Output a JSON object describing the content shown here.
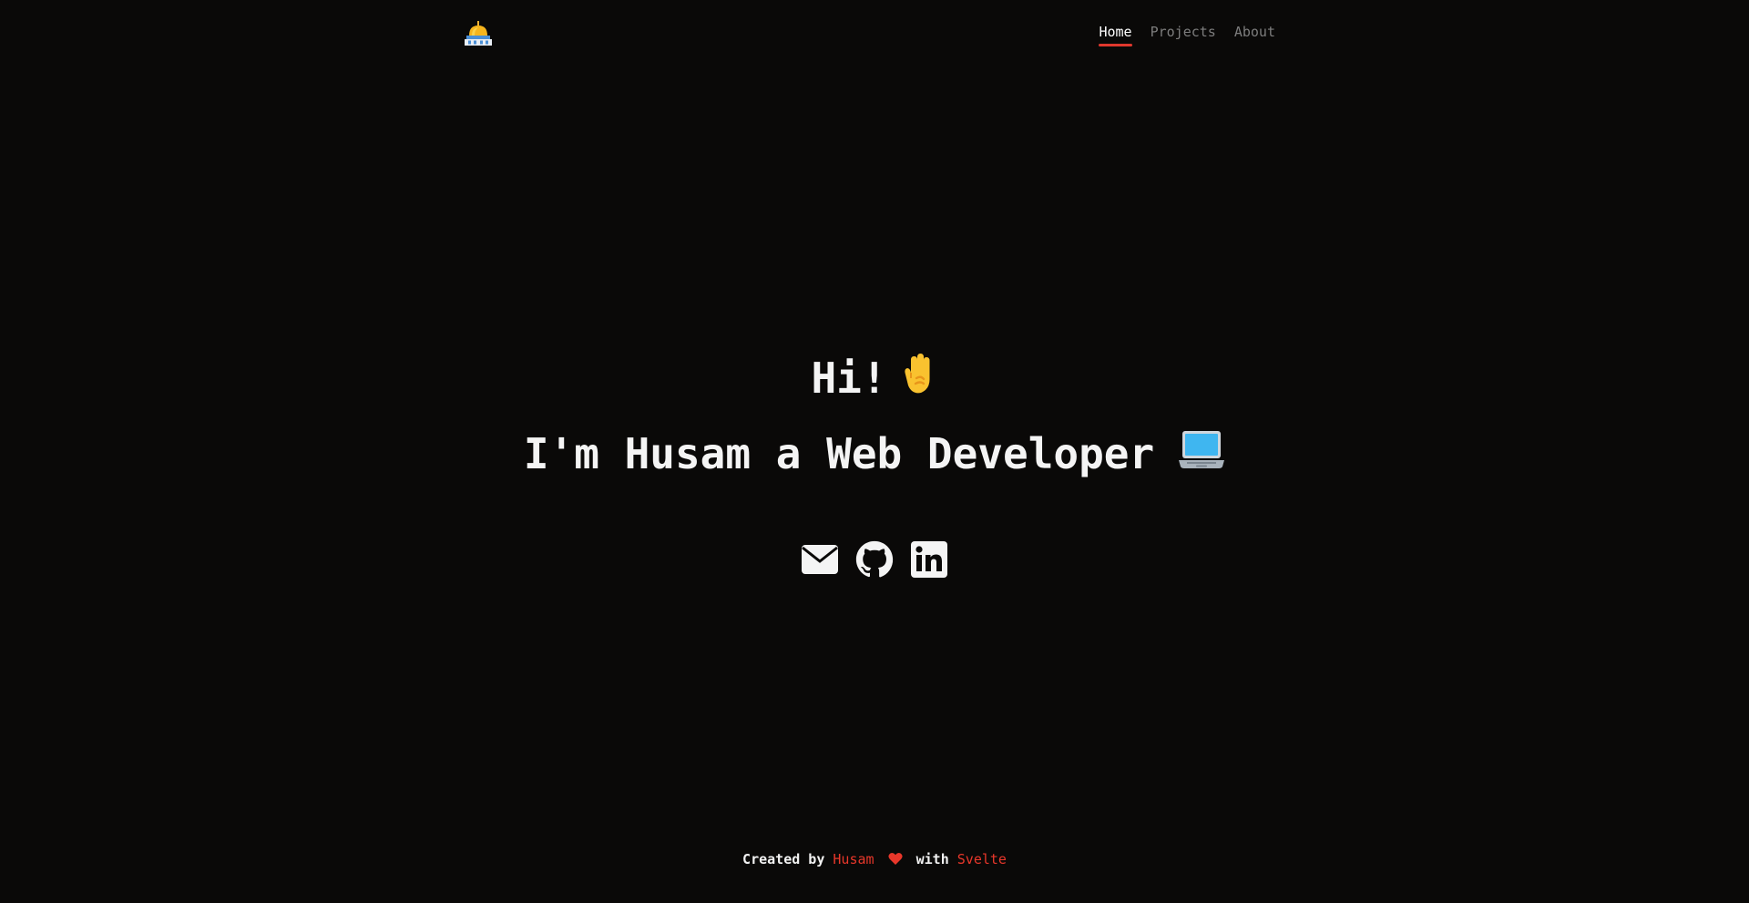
{
  "colors": {
    "background": "#0a0908",
    "text": "#f2f2f2",
    "nav_inactive": "#7d7d7d",
    "accent": "#e0382d"
  },
  "header": {
    "logo_icon": "mosque-dome-icon",
    "nav": [
      {
        "label": "Home",
        "active": true
      },
      {
        "label": "Projects",
        "active": false
      },
      {
        "label": "About",
        "active": false
      }
    ]
  },
  "hero": {
    "greeting": "Hi!",
    "greeting_icon": "raised-hand-icon",
    "headline": "I'm Husam a Web Developer",
    "headline_icon": "laptop-icon"
  },
  "socials": [
    {
      "icon": "email-icon"
    },
    {
      "icon": "github-icon"
    },
    {
      "icon": "linkedin-icon"
    }
  ],
  "footer": {
    "prefix": "Created by",
    "author": "Husam",
    "heart_icon": "heart-icon",
    "middle": "with",
    "framework": "Svelte"
  }
}
